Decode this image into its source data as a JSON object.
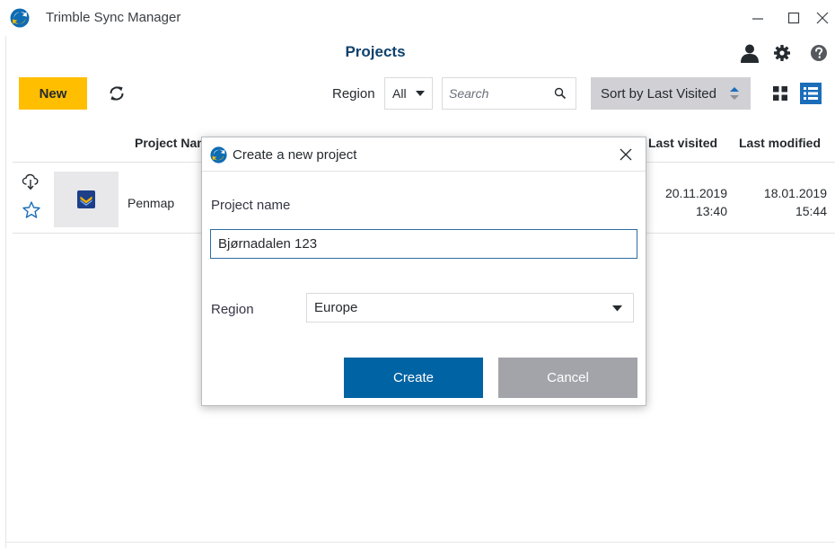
{
  "window": {
    "title": "Trimble Sync Manager",
    "logo_icon": "trimble-sync-logo-icon"
  },
  "header": {
    "title": "Projects",
    "icons": [
      "user-icon",
      "gear-icon",
      "help-icon"
    ]
  },
  "toolbar": {
    "new_label": "New",
    "region_label": "Region",
    "region_value": "All",
    "search_placeholder": "Search",
    "sort_label": "Sort by Last Visited"
  },
  "table": {
    "columns": {
      "name": "Project Name",
      "last_visited": "Last visited",
      "last_modified": "Last modified"
    },
    "rows": [
      {
        "name": "Penmap",
        "last_visited_date": "20.11.2019",
        "last_visited_time": "13:40",
        "last_modified_date": "18.01.2019",
        "last_modified_time": "15:44"
      }
    ]
  },
  "dialog": {
    "title": "Create a new project",
    "project_name_label": "Project name",
    "project_name_value": "Bjørnadalen 123",
    "region_label": "Region",
    "region_value": "Europe",
    "create_label": "Create",
    "cancel_label": "Cancel"
  },
  "colors": {
    "accent_yellow": "#ffbe00",
    "primary_blue": "#0063a3",
    "title_blue": "#0e416c",
    "disabled_gray": "#a3a3aa"
  }
}
